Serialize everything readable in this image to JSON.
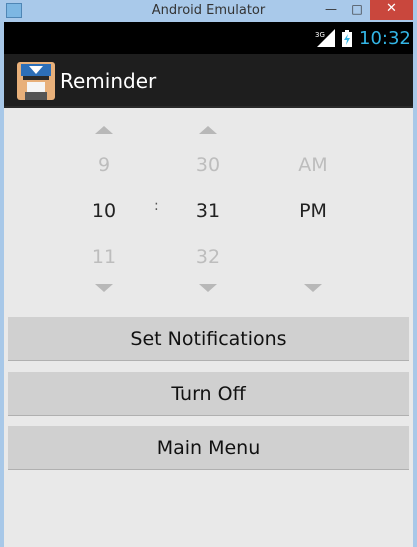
{
  "window": {
    "title": "Android Emulator",
    "minimize_glyph": "—",
    "maximize_glyph": "□",
    "close_glyph": "✕"
  },
  "status_bar": {
    "network": "3G",
    "time": "10:32",
    "accent_color": "#33b5e5"
  },
  "action_bar": {
    "title": "Reminder",
    "icon": "avatar-icon"
  },
  "time_picker": {
    "hour": {
      "prev": "9",
      "current": "10",
      "next": "11"
    },
    "separator": ":",
    "minute": {
      "prev": "30",
      "current": "31",
      "next": "32"
    },
    "ampm": {
      "prev": "AM",
      "current": "PM"
    }
  },
  "buttons": {
    "set_notifications": "Set Notifications",
    "turn_off": "Turn Off",
    "main_menu": "Main Menu"
  }
}
